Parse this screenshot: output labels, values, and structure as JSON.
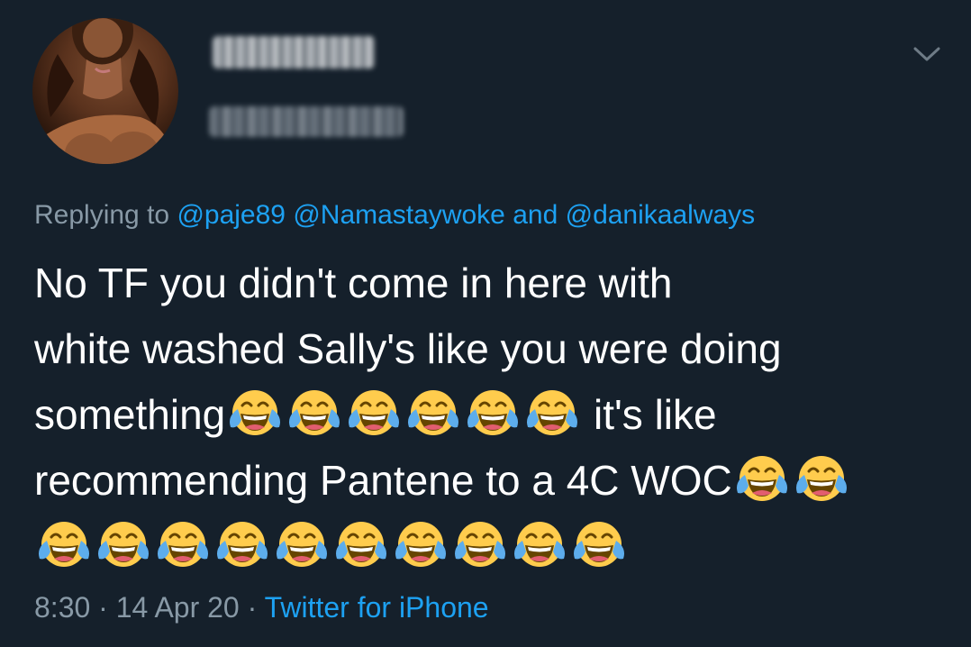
{
  "reply": {
    "prefix": "Replying to ",
    "mention1": "@paje89",
    "mention2": "@Namastaywoke",
    "conjunction": " and ",
    "mention3": "@danikaalways"
  },
  "tweet": {
    "line1": "No TF you didn't come in here with",
    "line2": "white washed Sally's like you were doing",
    "line3_a": "something",
    "line3_b": " it's like",
    "line4": "recommending Pantene to a 4C WOC"
  },
  "meta": {
    "time": "8:30",
    "separator": " · ",
    "date": "14 Apr 20",
    "source": "Twitter for iPhone"
  },
  "colors": {
    "background": "#15202b",
    "text": "#ffffff",
    "secondary": "#8899a6",
    "accent": "#1da1f2"
  },
  "icons": {
    "emoji": "face-with-tears-of-joy",
    "menu": "chevron-down-icon"
  }
}
